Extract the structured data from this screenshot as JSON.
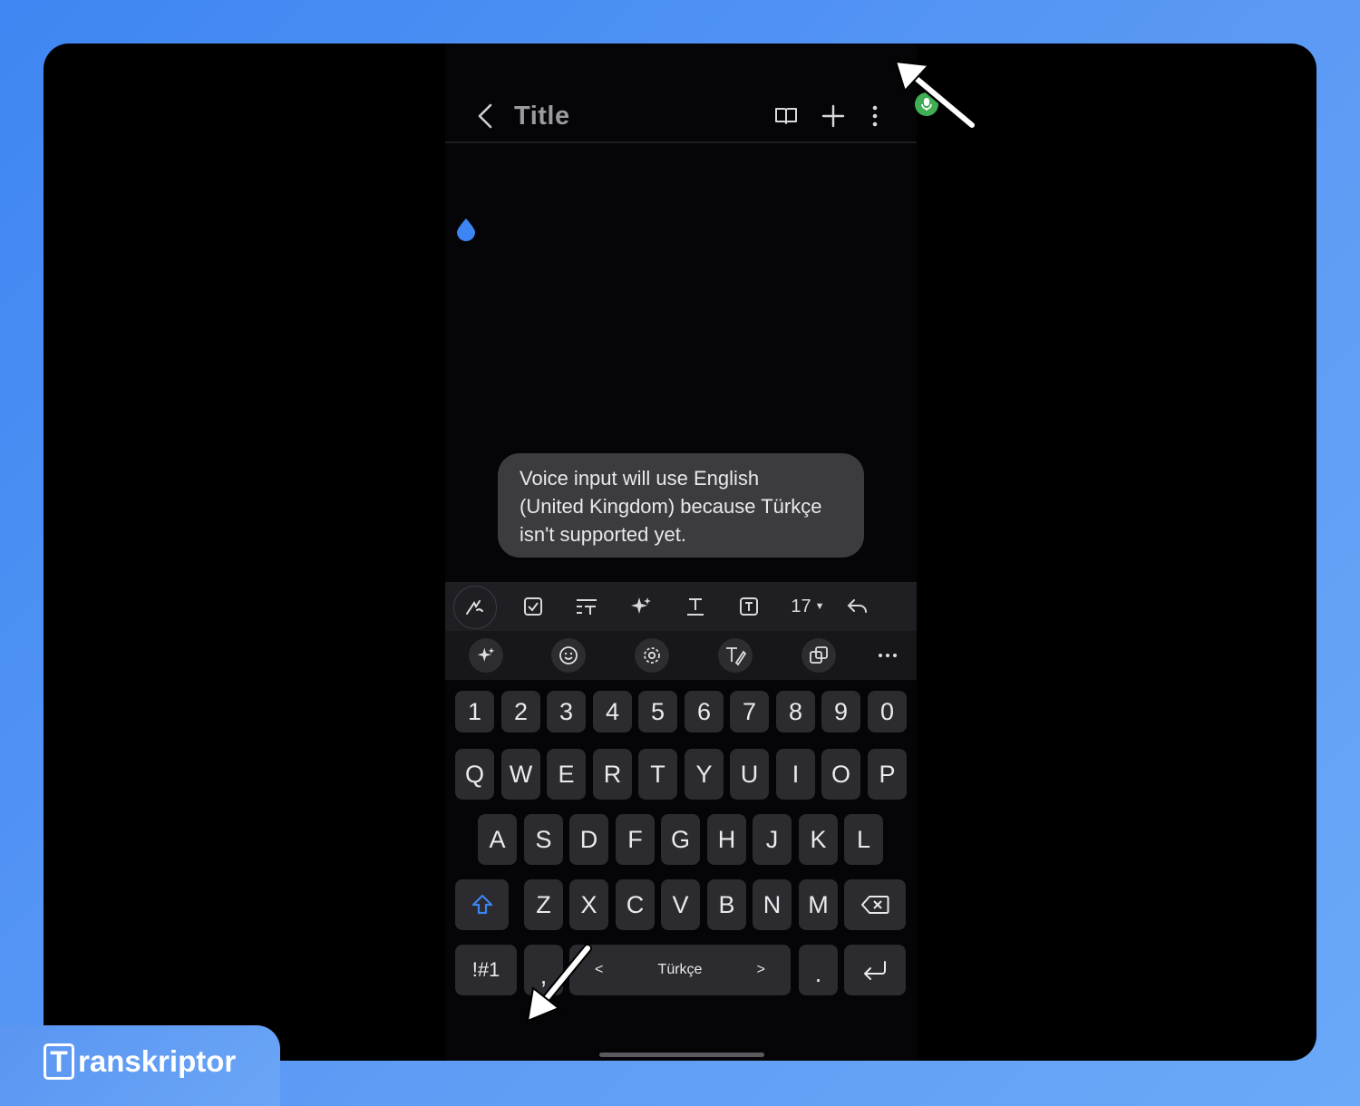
{
  "header": {
    "title": "Title"
  },
  "toast": {
    "line1": "Voice input will use English",
    "line2": "(United Kingdom) because Türkçe",
    "line3": "isn't supported yet."
  },
  "toolbar": {
    "font_size": "17"
  },
  "keyboard": {
    "numbers": [
      "1",
      "2",
      "3",
      "4",
      "5",
      "6",
      "7",
      "8",
      "9",
      "0"
    ],
    "row1": [
      "Q",
      "W",
      "E",
      "R",
      "T",
      "Y",
      "U",
      "I",
      "O",
      "P"
    ],
    "row2": [
      "A",
      "S",
      "D",
      "F",
      "G",
      "H",
      "J",
      "K",
      "L"
    ],
    "row3": [
      "Z",
      "X",
      "C",
      "V",
      "B",
      "N",
      "M"
    ],
    "symbols_key": "!#1",
    "comma_key": ",",
    "space_label": "Türkçe",
    "space_left": "<",
    "space_right": ">",
    "period_key": "."
  },
  "brand": {
    "logo_letter": "T",
    "name": "ranskriptor"
  },
  "colors": {
    "accent_blue": "#3d85f3",
    "mic_green": "#3fae55",
    "toast_bg": "#3b3b40",
    "key_bg": "#2b2b30"
  }
}
